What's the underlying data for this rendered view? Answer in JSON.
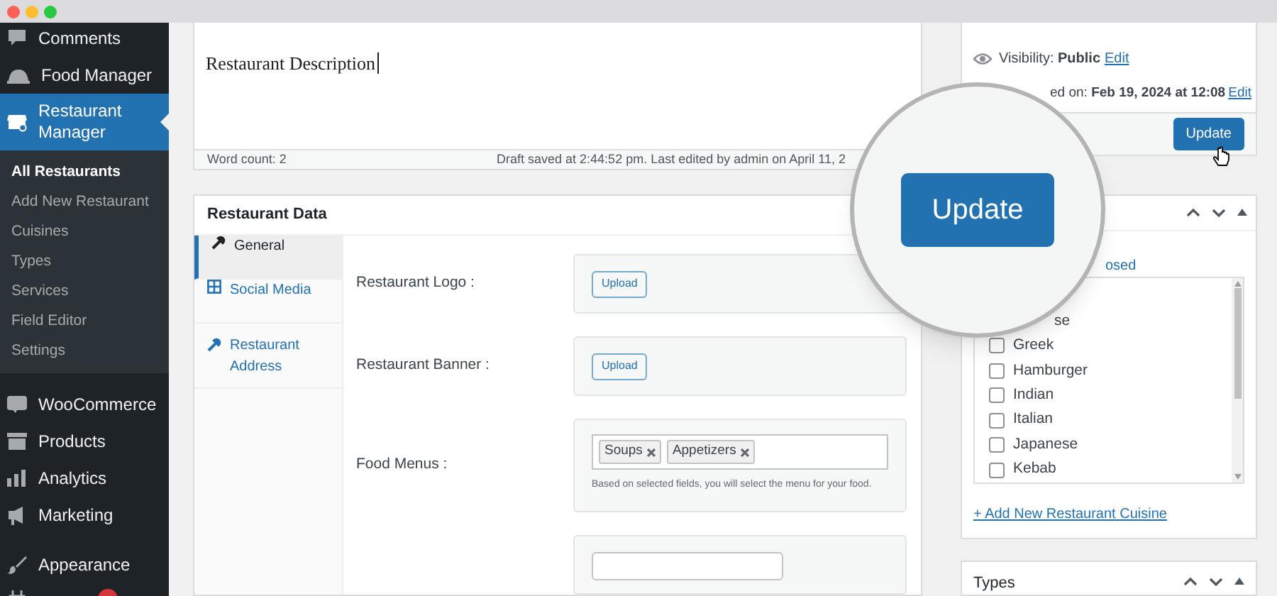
{
  "sidebar": {
    "items": [
      {
        "kind": "item",
        "label": "Comments",
        "selected": false
      },
      {
        "kind": "item",
        "label": "Food Manager",
        "selected": false
      },
      {
        "kind": "item",
        "label": "Restaurant Manager",
        "selected": true,
        "submenu": [
          {
            "label": "All Restaurants",
            "selected": true
          },
          {
            "label": "Add New Restaurant",
            "selected": false
          },
          {
            "label": "Cuisines",
            "selected": false
          },
          {
            "label": "Types",
            "selected": false
          },
          {
            "label": "Services",
            "selected": false
          },
          {
            "label": "Field Editor",
            "selected": false
          },
          {
            "label": "Settings",
            "selected": false
          }
        ]
      },
      {
        "kind": "item",
        "label": "WooCommerce",
        "selected": false
      },
      {
        "kind": "item",
        "label": "Products",
        "selected": false
      },
      {
        "kind": "item",
        "label": "Analytics",
        "selected": false
      },
      {
        "kind": "item",
        "label": "Marketing",
        "selected": false
      },
      {
        "kind": "item",
        "label": "Appearance",
        "selected": false
      },
      {
        "kind": "partial",
        "selected": false
      }
    ]
  },
  "editor": {
    "content": "Restaurant Description",
    "word_count": "Word count: 2",
    "status": "Draft saved at 2:44:52 pm. Last edited by admin on April 11, 2"
  },
  "restaurant_data": {
    "title": "Restaurant Data",
    "tabs": [
      {
        "label": "General",
        "selected": true
      },
      {
        "label": "Social Media",
        "selected": false
      },
      {
        "label": "Restaurant Address",
        "selected": false
      }
    ],
    "fields": [
      {
        "kind": "upload",
        "label": "Restaurant Logo :",
        "button": "Upload"
      },
      {
        "kind": "upload",
        "label": "Restaurant Banner :",
        "button": "Upload"
      },
      {
        "kind": "tags",
        "label": "Food Menus :",
        "tags": [
          "Soups",
          "Appetizers"
        ],
        "help": "Based on selected fields, you will select the menu for your food."
      },
      {
        "kind": "select"
      }
    ]
  },
  "publish": {
    "visibility_label": "Visibility:",
    "visibility": "Public",
    "visibility_edit": "Edit",
    "published_label": "ed on:",
    "published": "Feb 19, 2024 at 12:08",
    "published_edit": "Edit",
    "button": "Update"
  },
  "cuisines": {
    "tab_link": "osed",
    "items": [
      {
        "kind": "partial",
        "label": "se"
      },
      {
        "kind": "checkbox",
        "label": "Greek",
        "checked": false
      },
      {
        "kind": "checkbox",
        "label": "Hamburger",
        "checked": false
      },
      {
        "kind": "checkbox",
        "label": "Indian",
        "checked": false
      },
      {
        "kind": "checkbox",
        "label": "Italian",
        "checked": false
      },
      {
        "kind": "checkbox",
        "label": "Japanese",
        "checked": false
      },
      {
        "kind": "checkbox",
        "label": "Kebab",
        "checked": false
      }
    ],
    "add_link": "+ Add New Restaurant Cuisine"
  },
  "types": {
    "title": "Types"
  },
  "magnifier": {
    "button": "Update"
  }
}
